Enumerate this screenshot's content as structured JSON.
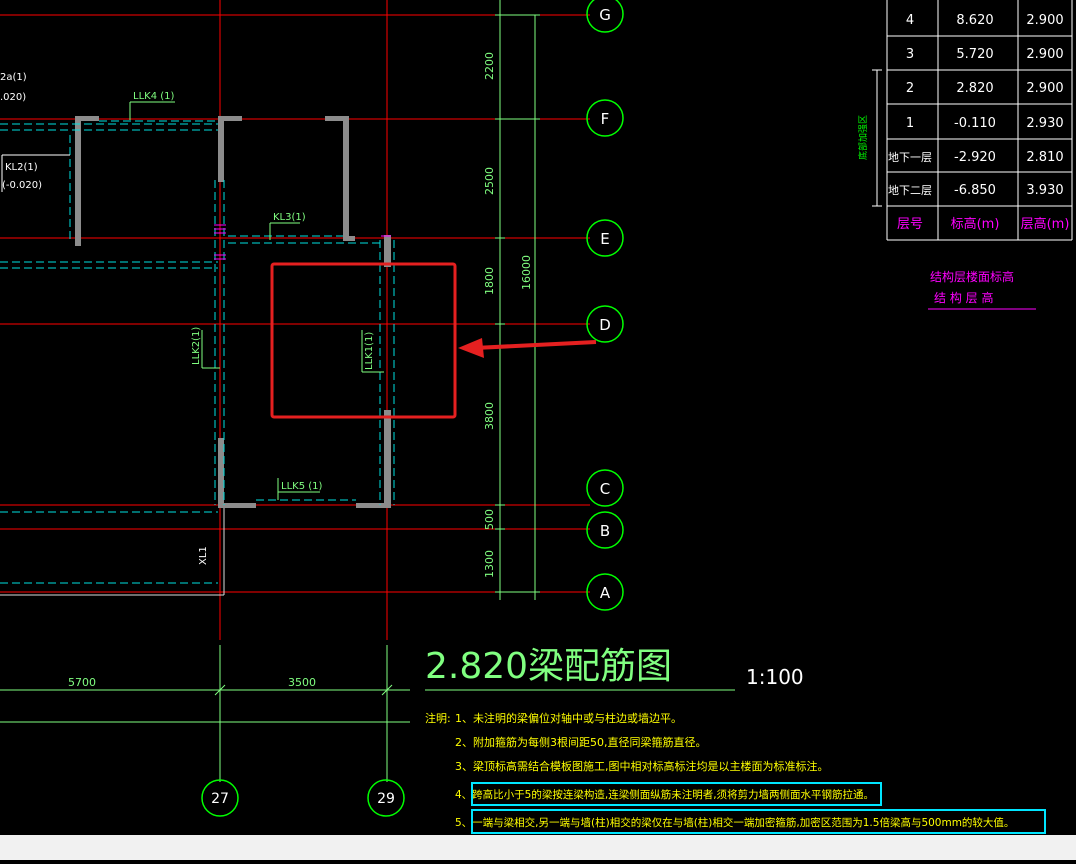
{
  "drawing": {
    "title": "2.820梁配筋图",
    "scale": "1:100",
    "axes_letters": [
      "G",
      "F",
      "E",
      "D",
      "C",
      "B",
      "A"
    ],
    "axes_numbers": [
      "27",
      "29"
    ],
    "dimensions": {
      "vertical": [
        "2200",
        "2500",
        "1800",
        "3800",
        "500",
        "1300"
      ],
      "vertical_total": "16000",
      "horizontal": [
        "5700",
        "3500"
      ]
    },
    "beam_labels": {
      "llk4": "LLK4 (1)",
      "kl3": "KL3(1)",
      "kl2": "KL2(1)",
      "kl2_elev": "(-0.020)",
      "partial_label": "2a(1)",
      "partial_elev": ".020)",
      "llk2": "LLK2(1)",
      "llk1": "LLK1(1)",
      "llk5": "LLK5 (1)",
      "xl1": "XL1"
    }
  },
  "floor_table": {
    "rows": [
      {
        "floor": "4",
        "elevation": "8.620",
        "height": "2.900"
      },
      {
        "floor": "3",
        "elevation": "5.720",
        "height": "2.900"
      },
      {
        "floor": "2",
        "elevation": "2.820",
        "height": "2.900"
      },
      {
        "floor": "1",
        "elevation": "-0.110",
        "height": "2.930"
      },
      {
        "floor": "地下一层",
        "elevation": "-2.920",
        "height": "2.810"
      },
      {
        "floor": "地下二层",
        "elevation": "-6.850",
        "height": "3.930"
      }
    ],
    "header": {
      "floor": "层号",
      "elevation": "标高(m)",
      "height": "层高(m)"
    },
    "side_label": "底部加强区",
    "caption_line1": "结构层楼面标高",
    "caption_line2": "结 构 层 高"
  },
  "notes": {
    "prefix": "注明:",
    "items": [
      "1、未注明的梁偏位对轴中或与柱边或墙边平。",
      "2、附加箍筋为每侧3根间距50,直径同梁箍筋直径。",
      "3、梁顶标高需结合模板图施工,图中相对标高标注均是以主楼面为标准标注。",
      "4、跨高比小于5的梁按连梁构造,连梁侧面纵筋未注明者,须将剪力墙两侧面水平钢筋拉通。",
      "5、一端与梁相交,另一端与墙(柱)相交的梁仅在与墙(柱)相交一端加密箍筋,加密区范围为1.5倍梁高与500mm的较大值。"
    ]
  },
  "colors": {
    "background": "#000000",
    "axis_red": "#ff0000",
    "axis_circle": "#00ff00",
    "dim_green": "#80ff80",
    "wall_gray": "#8c8c8c",
    "beam_cyan": "#00e0e0",
    "magenta": "#ff00ff",
    "note_yellow": "#ffff00",
    "highlight_red": "#e52020",
    "highlight_cyan": "#00e5ff",
    "table_white": "#ffffff"
  }
}
